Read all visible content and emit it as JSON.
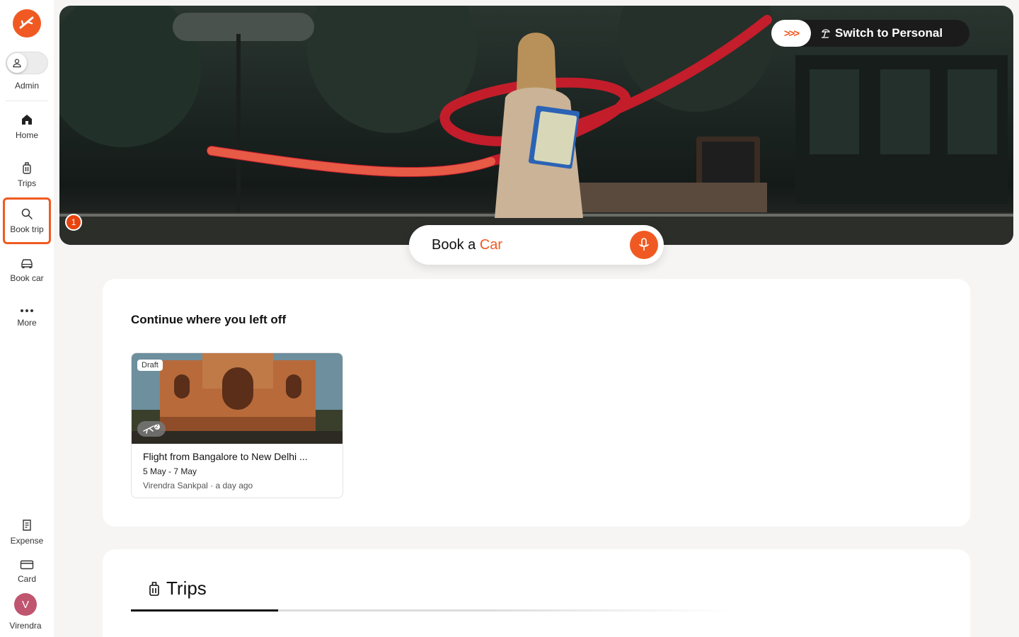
{
  "sidebar": {
    "admin_label": "Admin",
    "items": [
      {
        "label": "Home",
        "icon": "home-icon"
      },
      {
        "label": "Trips",
        "icon": "luggage-icon"
      },
      {
        "label": "Book trip",
        "icon": "search-icon"
      },
      {
        "label": "Book car",
        "icon": "car-icon"
      },
      {
        "label": "More",
        "icon": "more-icon"
      }
    ],
    "bottom_items": [
      {
        "label": "Expense",
        "icon": "receipt-icon"
      },
      {
        "label": "Card",
        "icon": "card-icon"
      }
    ],
    "user_initial": "V",
    "user_name": "Virendra"
  },
  "hero": {
    "switch_label": "Switch to Personal",
    "step_badge": "1",
    "book_prefix": "Book a",
    "book_accent": "Car"
  },
  "continue": {
    "title": "Continue where you left off",
    "card": {
      "tag": "Draft",
      "title": "Flight from Bangalore to New Delhi ...",
      "dates": "5 May - 7 May",
      "meta": "Virendra Sankpal · a day ago",
      "mode_count": "2"
    }
  },
  "trips": {
    "title": "Trips"
  },
  "colors": {
    "accent": "#f05a22",
    "avatar": "#c05570"
  }
}
